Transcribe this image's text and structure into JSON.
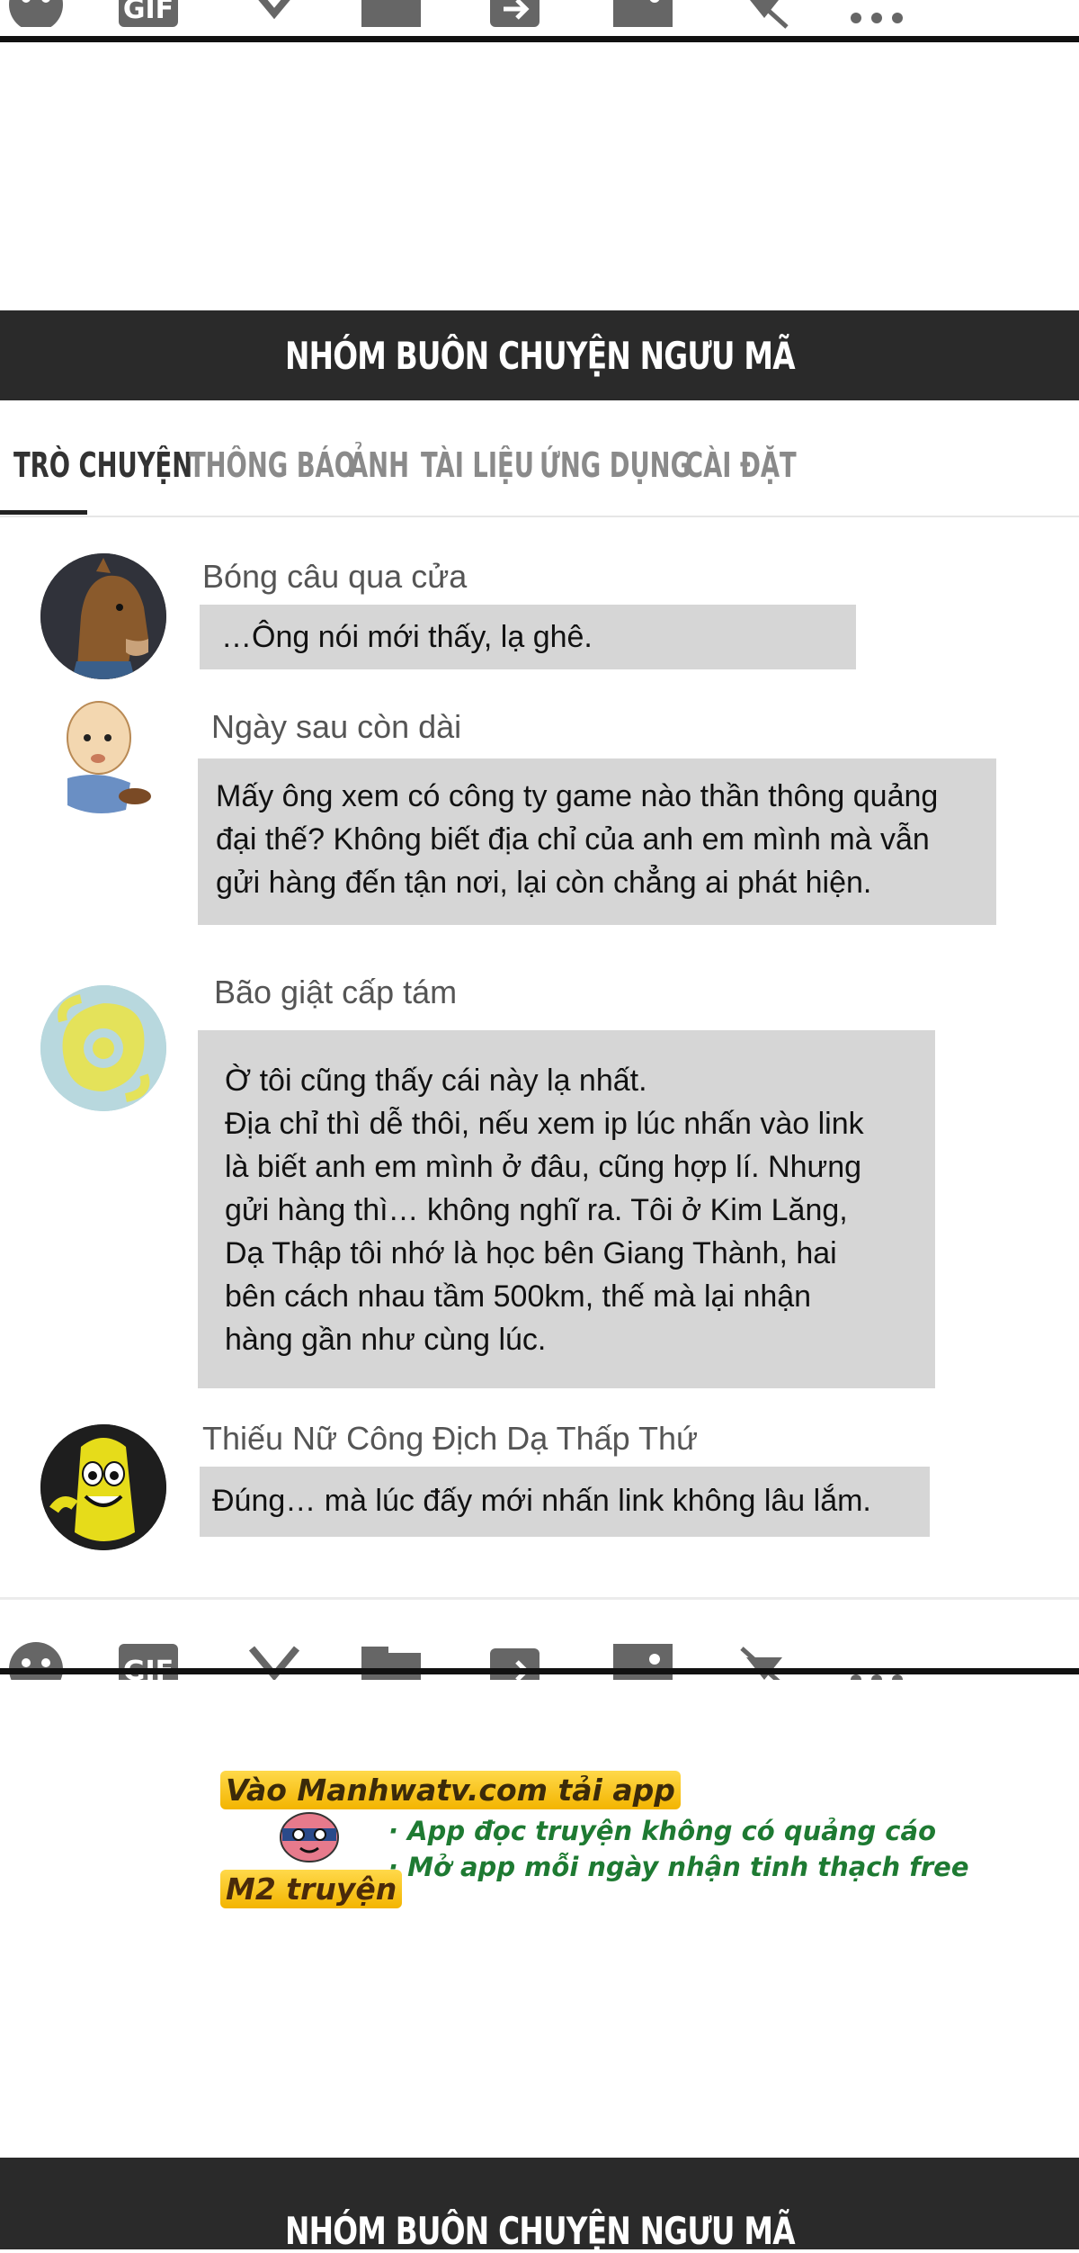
{
  "group_title": "NHÓM BUÔN CHUYỆN NGƯU MÃ",
  "tabs": [
    {
      "label": "TRÒ CHUYỆN",
      "active": true
    },
    {
      "label": "THÔNG BÁO",
      "active": false
    },
    {
      "label": "ẢNH",
      "active": false
    },
    {
      "label": "TÀI LIỆU",
      "active": false
    },
    {
      "label": "ỨNG DỤNG",
      "active": false
    },
    {
      "label": "CÀI ĐẶT",
      "active": false
    }
  ],
  "toolbar_icons": [
    "emoji-icon",
    "gif-icon",
    "scissors-icon",
    "folder-icon",
    "share-icon",
    "image-icon",
    "mute-icon",
    "more-icon"
  ],
  "messages": [
    {
      "sender": "Bóng câu qua cửa",
      "avatar": "horse-avatar",
      "text": "…Ông nói mới thấy, lạ ghê."
    },
    {
      "sender": "Ngày sau còn dài",
      "avatar": "old-man-avatar",
      "text": "Mấy ông xem có công ty game nào thần thông quảng\nđại thế? Không biết địa chỉ của anh em mình mà vẫn\ngửi hàng đến tận nơi, lại còn chẳng ai phát hiện."
    },
    {
      "sender": "Bão giật cấp tám",
      "avatar": "typhoon-avatar",
      "text": "Ờ tôi cũng thấy cái này lạ nhất.\nĐịa chỉ thì dễ thôi, nếu xem ip lúc nhấn vào link\nlà biết anh em mình ở đâu, cũng hợp lí. Nhưng\ngửi hàng thì… không nghĩ ra. Tôi ở Kim Lăng,\nDạ Thập tôi nhớ là học bên Giang Thành, hai\nbên cách nhau tầm 500km, thế mà lại nhận\nhàng gần như cùng lúc."
    },
    {
      "sender": "Thiếu Nữ Công Địch Dạ Thấp Thứ",
      "avatar": "banana-avatar",
      "text": "Đúng… mà lúc đấy mới nhấn link không lâu lắm."
    }
  ],
  "promo": {
    "headline": "Vào Manhwatv.com tải app",
    "line1": "· App đọc truyện không có quảng cáo",
    "line2": "· Mở app mỗi ngày nhận tinh thạch free",
    "brand": "M2 truyện"
  },
  "colors": {
    "titlebar": "#2a2a2a",
    "bubble": "#d6d6d6",
    "active_tab": "#333333",
    "inactive_tab": "#8a8a8a",
    "promo_green": "#1e7a32",
    "promo_yellow": "#f3b400"
  }
}
